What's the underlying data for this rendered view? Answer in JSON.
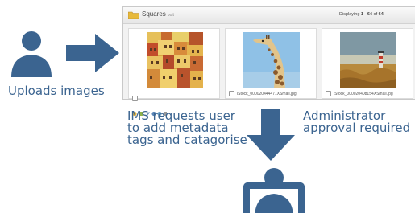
{
  "labels": {
    "uploads": "Uploads images",
    "ims_line1": "IMS requests user",
    "ims_line2": "to add metadata",
    "ims_line3": "tags and catagorise",
    "admin_line1": "Administrator",
    "admin_line2": "approval required"
  },
  "window": {
    "title": "Squares",
    "subtitle": "bolt",
    "count_prefix": "Displaying",
    "count_from": "1",
    "count_sep": "-",
    "count_to": "64",
    "count_of": "of",
    "count_total": "64"
  },
  "cards": [
    {
      "caption": "",
      "image": "colorful-hillside-houses"
    },
    {
      "caption": "iStock_000020444471XSmall.jpg",
      "image": "giraffe"
    },
    {
      "caption": "iStock_000020408154XSmall.jpg",
      "image": "lighthouse-field"
    }
  ],
  "icons": {
    "user": "user-icon",
    "arrow_right": "arrow-right-icon",
    "arrow_down": "arrow-down-icon",
    "admin": "admin-laptop-icon",
    "folder": "folder-icon"
  },
  "colors": {
    "icon_blue": "#3b6490",
    "text_blue": "#3b6490"
  }
}
